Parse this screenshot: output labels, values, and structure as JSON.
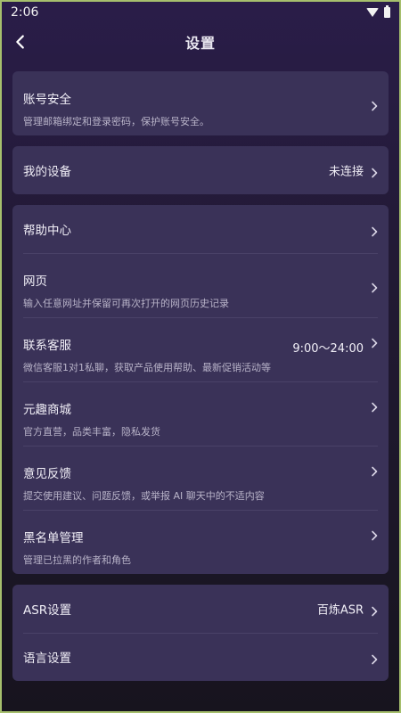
{
  "status": {
    "time": "2:06"
  },
  "header": {
    "title": "设置"
  },
  "account": {
    "title": "账号安全",
    "subtitle": "管理邮箱绑定和登录密码，保护账号安全。"
  },
  "device": {
    "title": "我的设备",
    "value": "未连接"
  },
  "group2": {
    "help": {
      "title": "帮助中心"
    },
    "web": {
      "title": "网页",
      "subtitle": "输入任意网址并保留可再次打开的网页历史记录"
    },
    "support": {
      "title": "联系客服",
      "value": "9:00～24:00",
      "subtitle": "微信客服1对1私聊，获取产品使用帮助、最新促销活动等"
    },
    "shop": {
      "title": "元趣商城",
      "subtitle": "官方直营，品类丰富，隐私发货"
    },
    "feedback": {
      "title": "意见反馈",
      "subtitle": "提交使用建议、问题反馈，或举报 AI 聊天中的不适内容"
    },
    "blacklist": {
      "title": "黑名单管理",
      "subtitle": "管理已拉黑的作者和角色"
    }
  },
  "group3": {
    "asr": {
      "title": "ASR设置",
      "value": "百炼ASR"
    },
    "language": {
      "title": "语言设置"
    }
  },
  "icons": {
    "back": "back-arrow-icon",
    "chevron": "chevron-right-icon"
  }
}
